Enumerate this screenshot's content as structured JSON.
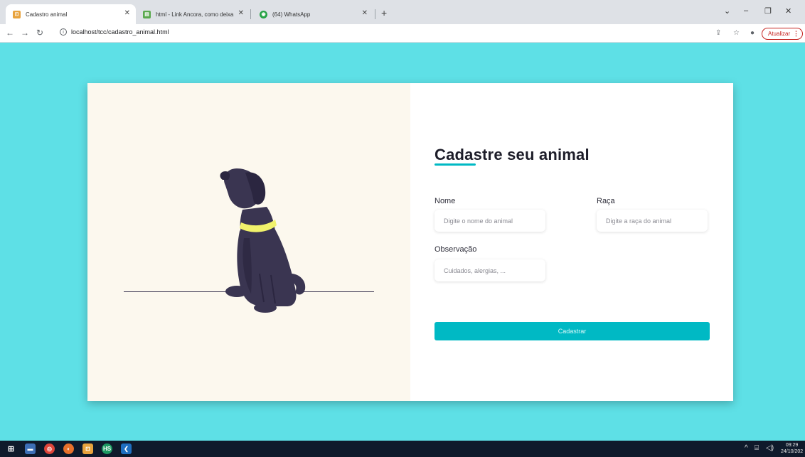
{
  "browser": {
    "tabs": [
      {
        "title": "Cadastro animal",
        "active": true
      },
      {
        "title": "html - Link Ancora, como deixa",
        "active": false
      },
      {
        "title": "(64) WhatsApp",
        "active": false
      }
    ],
    "url": "localhost/tcc/cadastro_animal.html",
    "update_label": "Atualizar"
  },
  "form": {
    "title": "Cadastre seu animal",
    "fields": {
      "nome": {
        "label": "Nome",
        "placeholder": "Digite o nome do animal"
      },
      "raca": {
        "label": "Raça",
        "placeholder": "Digite a raça do animal"
      },
      "observacao": {
        "label": "Observação",
        "placeholder": "Cuidados, alergias, ..."
      }
    },
    "submit_label": "Cadastrar"
  },
  "taskbar": {
    "time": "09:29",
    "date": "24/10/202"
  },
  "colors": {
    "page_background": "#5ee0e6",
    "accent": "#00b9c4",
    "illustration_panel": "#fcf8ee",
    "dog_body": "#3a3551",
    "dog_collar": "#f1f26b"
  }
}
